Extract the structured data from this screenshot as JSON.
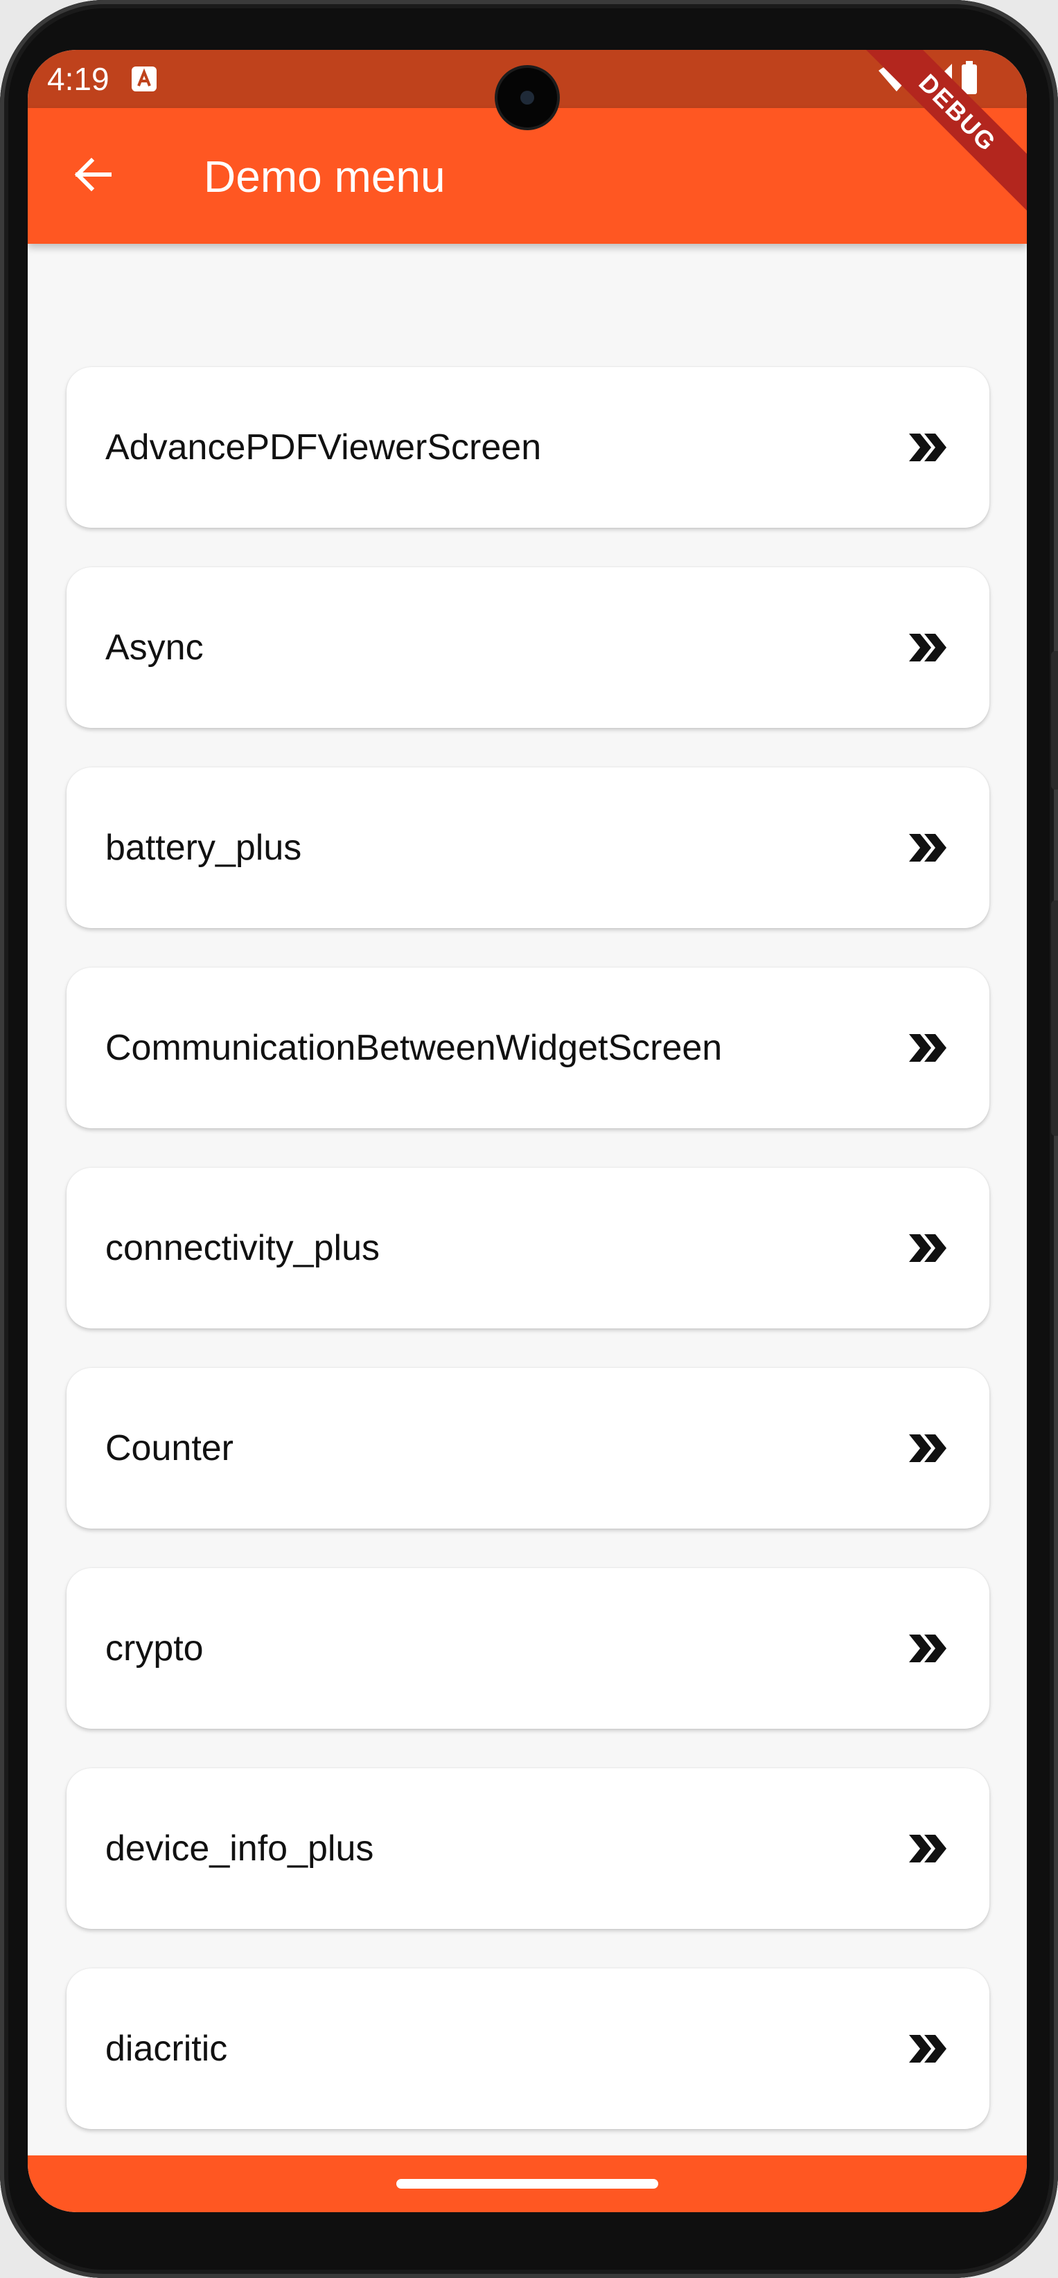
{
  "status_bar": {
    "time": "4:19",
    "background": "#bf421c",
    "icons": [
      "a-notification-icon",
      "wifi-icon",
      "signal-icon",
      "battery-icon"
    ]
  },
  "app_bar": {
    "title": "Demo menu",
    "background": "#ff5722",
    "back_icon": "arrow-back-icon"
  },
  "debug_banner": {
    "text": "DEBUG"
  },
  "menu": {
    "items": [
      {
        "label": "AdvancePDFViewerScreen"
      },
      {
        "label": "Async"
      },
      {
        "label": "battery_plus"
      },
      {
        "label": "CommunicationBetweenWidgetScreen"
      },
      {
        "label": "connectivity_plus"
      },
      {
        "label": "Counter"
      },
      {
        "label": "crypto"
      },
      {
        "label": "device_info_plus"
      },
      {
        "label": "diacritic"
      }
    ],
    "trailing_icon": "double-chevron-right-icon"
  },
  "nav_bar": {
    "background": "#ff5722"
  }
}
